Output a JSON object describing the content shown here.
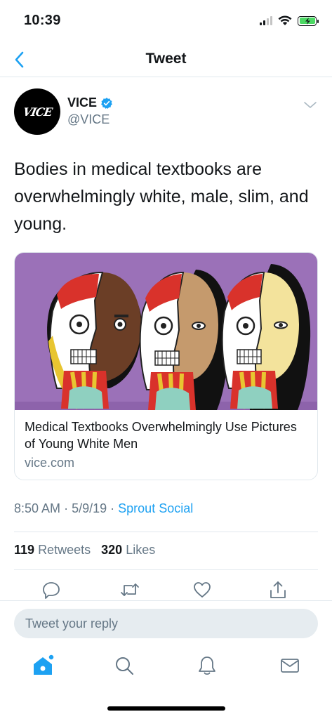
{
  "status_bar": {
    "time": "10:39"
  },
  "nav": {
    "title": "Tweet"
  },
  "tweet": {
    "author_name": "VICE",
    "author_handle": "@VICE",
    "avatar_text": "VICE",
    "text": "Bodies in medical textbooks are overwhelmingly white, male, slim, and young.",
    "card": {
      "title": "Medical Textbooks Overwhelmingly Use Pictures of Young White Men",
      "domain": "vice.com"
    },
    "time": "8:50 AM",
    "date": "5/9/19",
    "source": "Sprout Social",
    "separator": "·",
    "retweets_count": "119",
    "retweets_label": "Retweets",
    "likes_count": "320",
    "likes_label": "Likes"
  },
  "reply": {
    "placeholder": "Tweet your reply"
  },
  "icons": {
    "back": "chevron-left-icon",
    "verified": "verified-badge-icon",
    "caret": "chevron-down-icon",
    "actions": [
      "reply-icon",
      "retweet-icon",
      "like-icon",
      "share-icon"
    ],
    "tabs": [
      "home-icon",
      "search-icon",
      "notifications-icon",
      "messages-icon"
    ]
  },
  "colors": {
    "accent": "#1da1f2",
    "secondary_text": "#657786",
    "battery": "#4cd964",
    "card_bg": "#9b71b8"
  }
}
